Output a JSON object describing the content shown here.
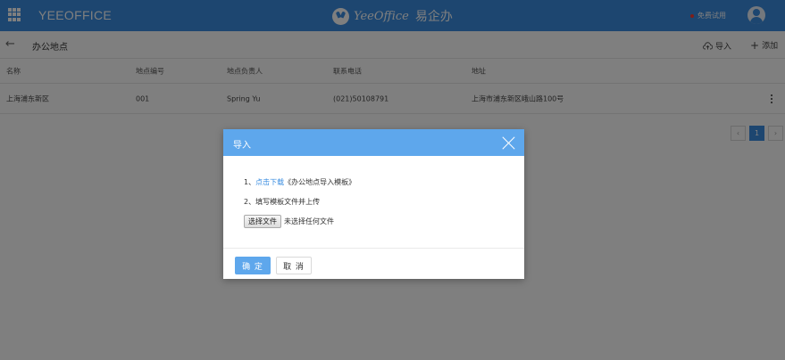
{
  "app": {
    "brand": "YEEOFFICE",
    "logo_text": "YeeOffice",
    "logo_cn": "易企办",
    "trial_label": "免费试用",
    "colors": {
      "header": "#3a8de0",
      "modal_header": "#5ea7ec",
      "trial_dot": "#ff3b30"
    }
  },
  "page": {
    "title": "办公地点",
    "import_label": "导入",
    "add_label": "添加"
  },
  "table": {
    "headers": [
      "名称",
      "地点编号",
      "地点负责人",
      "联系电话",
      "地址"
    ],
    "rows": [
      [
        "上海浦东新区",
        "001",
        "Spring Yu",
        "(021)50108791",
        "上海市浦东新区峨山路100号"
      ]
    ]
  },
  "pagination": {
    "current": "1"
  },
  "modal": {
    "title": "导入",
    "step1_prefix": "1、",
    "step1_link": "点击下载",
    "step1_suffix": "《办公地点导入模板》",
    "step2": "2、填写模板文件并上传",
    "file_button": "选择文件",
    "file_status": "未选择任何文件",
    "ok": "确 定",
    "cancel": "取 消"
  }
}
